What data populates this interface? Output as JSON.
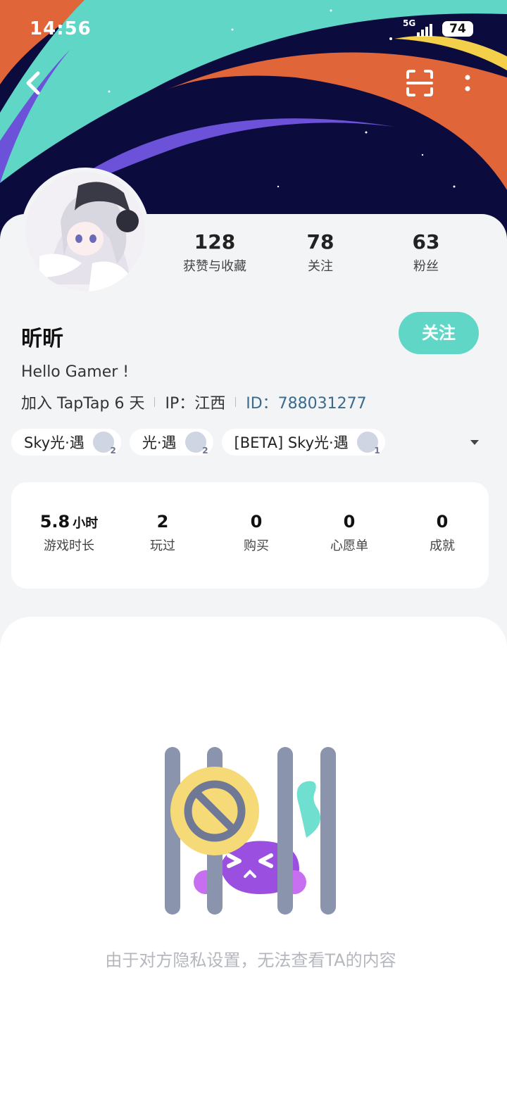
{
  "status_bar": {
    "time": "14:56",
    "network": "5G",
    "battery": "74"
  },
  "profile": {
    "stats": [
      {
        "value": "128",
        "label": "获赞与收藏"
      },
      {
        "value": "78",
        "label": "关注"
      },
      {
        "value": "63",
        "label": "粉丝"
      }
    ],
    "name": "昕昕",
    "follow_label": "关注",
    "bio": "Hello Gamer !",
    "joined": "加入 TapTap 6 天",
    "ip": "IP：江西",
    "id": "ID：788031277"
  },
  "game_chips": [
    {
      "label": "Sky光·遇",
      "badge": "2"
    },
    {
      "label": "光·遇",
      "badge": "2"
    },
    {
      "label": "[BETA] Sky光·遇",
      "badge": "1"
    }
  ],
  "game_stats": [
    {
      "value": "5.8",
      "unit": "小时",
      "label": "游戏时长"
    },
    {
      "value": "2",
      "label": "玩过"
    },
    {
      "value": "0",
      "label": "购买"
    },
    {
      "value": "0",
      "label": "心愿单"
    },
    {
      "value": "0",
      "label": "成就"
    }
  ],
  "privacy_message": "由于对方隐私设置，无法查看TA的内容",
  "colors": {
    "accent": "#5fd6c6",
    "id_text": "#3a6a8c",
    "hero_bg": "#0b0b3e"
  }
}
